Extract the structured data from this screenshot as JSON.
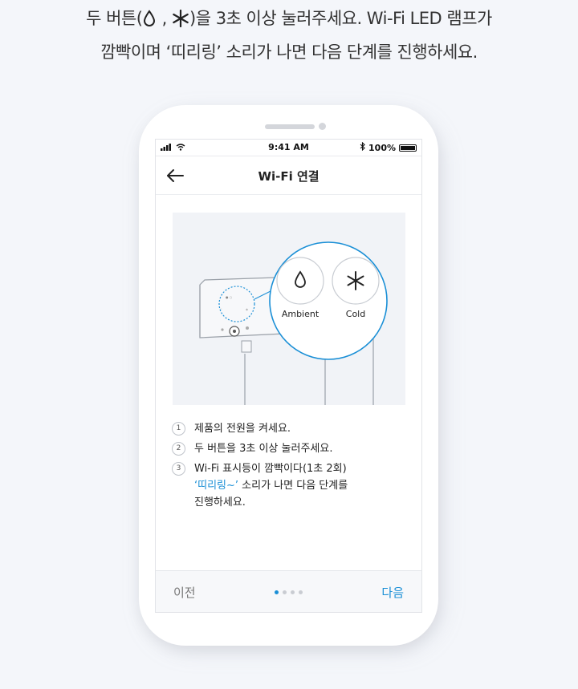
{
  "instruction": {
    "line1_pre": "두 버튼(",
    "line1_sep": " , ",
    "line1_post": ")을 3초 이상 눌러주세요. Wi-Fi LED 램프가",
    "line2": "깜빡이며 ‘띠리링’ 소리가 나면 다음 단계를 진행하세요."
  },
  "statusbar": {
    "time": "9:41 AM",
    "battery": "100%"
  },
  "navbar": {
    "title": "Wi-Fi 연결"
  },
  "illustration": {
    "button_left_label": "Ambient",
    "button_right_label": "Cold"
  },
  "steps": [
    {
      "num": "1",
      "text": "제품의 전원을 켜세요."
    },
    {
      "num": "2",
      "text": "두 버튼을 3초 이상 눌러주세요."
    },
    {
      "num": "3",
      "text": "Wi-Fi 표시등이 깜빡이다(1초 2회)",
      "highlight": "‘띠리링~’",
      "text2": " 소리가 나면 다음 단계를",
      "text3": "진행하세요."
    }
  ],
  "footer": {
    "prev_label": "이전",
    "next_label": "다음",
    "page_count": 4,
    "current_page": 1
  },
  "colors": {
    "accent": "#1a8fd6",
    "background": "#f4f6fa"
  },
  "icons": [
    "water-drop-icon",
    "snowflake-asterisk-icon",
    "back-arrow-icon",
    "signal-icon",
    "wifi-icon",
    "bluetooth-icon",
    "battery-icon"
  ]
}
